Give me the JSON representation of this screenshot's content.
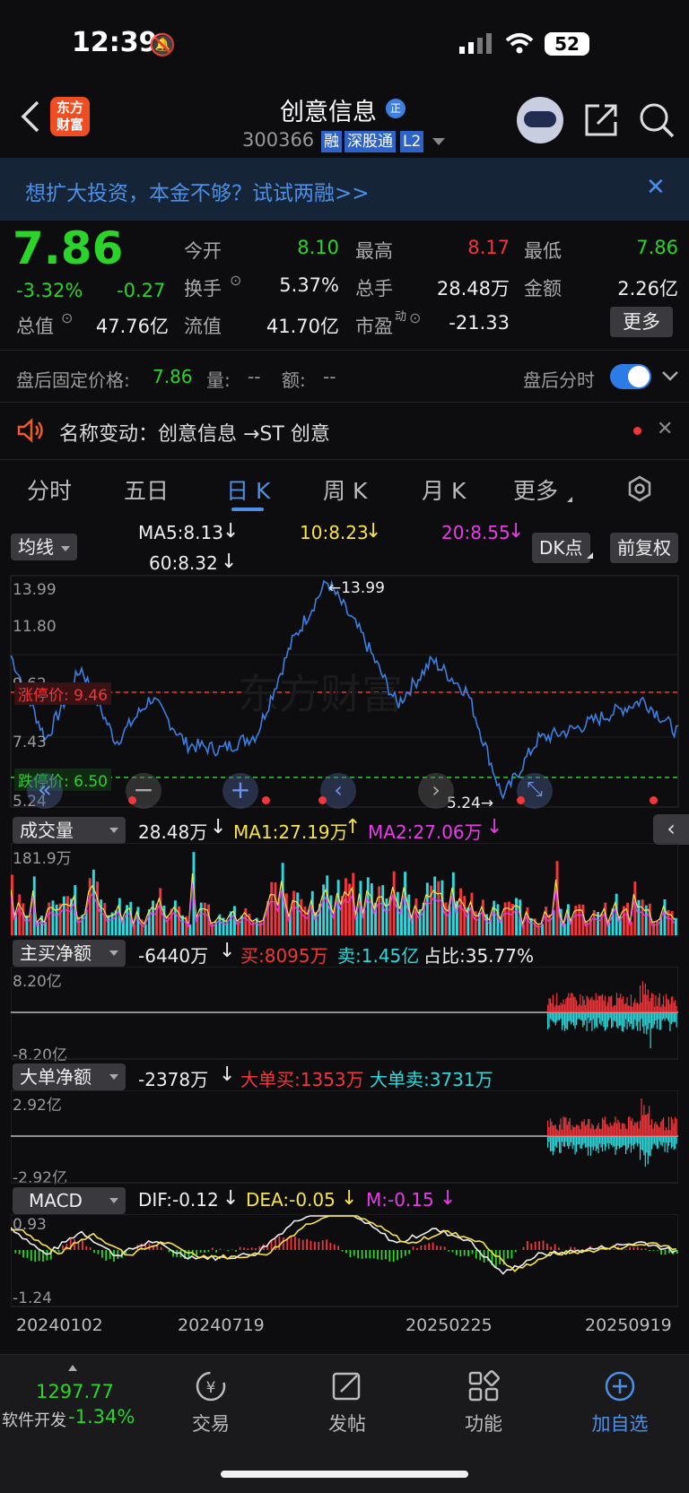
{
  "status": {
    "time": "12:39",
    "battery": "52"
  },
  "header": {
    "logo": "东方财富",
    "name": "创意信息",
    "name_badge": "正",
    "code": "300366",
    "tags": [
      "融",
      "深股通",
      "L2"
    ]
  },
  "banner": {
    "text": "想扩大投资，本金不够？试试两融>>"
  },
  "quote": {
    "price": "7.86",
    "pct": "-3.32%",
    "chg": "-0.27",
    "fields": [
      {
        "label": "今开",
        "value": "8.10",
        "color": "green"
      },
      {
        "label": "最高",
        "value": "8.17",
        "color": "red"
      },
      {
        "label": "最低",
        "value": "7.86",
        "color": "green"
      },
      {
        "label": "换手",
        "value": "5.37%",
        "color": "white"
      },
      {
        "label": "总手",
        "value": "28.48万",
        "color": "white"
      },
      {
        "label": "金额",
        "value": "2.26亿",
        "color": "white"
      },
      {
        "label": "总值",
        "value": "47.76亿",
        "color": "white"
      },
      {
        "label": "流值",
        "value": "41.70亿",
        "color": "white"
      },
      {
        "label": "市盈",
        "label_sup": "动",
        "value": "-21.33",
        "color": "white"
      }
    ],
    "more": "更多"
  },
  "after_hours": {
    "label": "盘后固定价格:",
    "price": "7.86",
    "vol_label": "量:",
    "vol": "--",
    "amt_label": "额:",
    "amt": "--",
    "switch_label": "盘后分时"
  },
  "notice": {
    "text": "名称变动：创意信息 →ST 创意"
  },
  "tabs": [
    "分时",
    "五日",
    "日 K",
    "周 K",
    "月 K",
    "更多"
  ],
  "active_tab": "日 K",
  "ma": {
    "selector": "均线",
    "ma5": "MA5:8.13",
    "ma10": "10:8.23",
    "ma20": "20:8.55",
    "ma60": "60:8.32",
    "dk": "DK点",
    "fq": "前复权"
  },
  "kline": {
    "y_top": "13.99",
    "y_2": "11.80",
    "y_3": "9.62",
    "y_4": "7.43",
    "y_bottom": "5.24",
    "high_mark": "←13.99",
    "low_mark": "5.24→",
    "limit_up": "涨停价: 9.46",
    "limit_down": "跌停价: 6.50"
  },
  "vol_panel": {
    "selector": "成交量",
    "v": "28.48万",
    "ma1": "MA1:27.19万",
    "ma2": "MA2:27.06万",
    "top": "181.9万"
  },
  "buy_panel": {
    "selector": "主买净额",
    "net": "-6440万",
    "buy": "买:8095万",
    "sell": "卖:1.45亿",
    "ratio": "占比:35.77%",
    "top": "8.20亿",
    "bottom": "-8.20亿"
  },
  "big_panel": {
    "selector": "大单净额",
    "net": "-2378万",
    "buy": "大单买:1353万",
    "sell": "大单卖:3731万",
    "top": "2.92亿",
    "bottom": "-2.92亿"
  },
  "macd": {
    "selector": "MACD",
    "dif": "DIF:-0.12",
    "dea": "DEA:-0.05",
    "m": "M:-0.15",
    "top": "0.93",
    "bottom": "-1.24"
  },
  "dates": [
    "20240102",
    "20240719",
    "20250225",
    "20250919"
  ],
  "bottom": {
    "index_val": "1297.77",
    "index_name": "软件开发",
    "index_pct": "-1.34%",
    "items": [
      "交易",
      "发帖",
      "功能",
      "加自选"
    ]
  },
  "chart_data": {
    "type": "line",
    "title": "",
    "x": [
      "20240102",
      "20240719",
      "20250225",
      "20250919"
    ],
    "ylim": [
      5.24,
      13.99
    ],
    "series": [
      {
        "name": "",
        "values": [
          11.0,
          7.6,
          10.5,
          7.5,
          9.3,
          7.4,
          7.2,
          7.8,
          11.5,
          13.99,
          11.8,
          9.0,
          10.8,
          9.5,
          5.24,
          7.6,
          8.0,
          8.6,
          9.2,
          7.86
        ]
      }
    ]
  }
}
